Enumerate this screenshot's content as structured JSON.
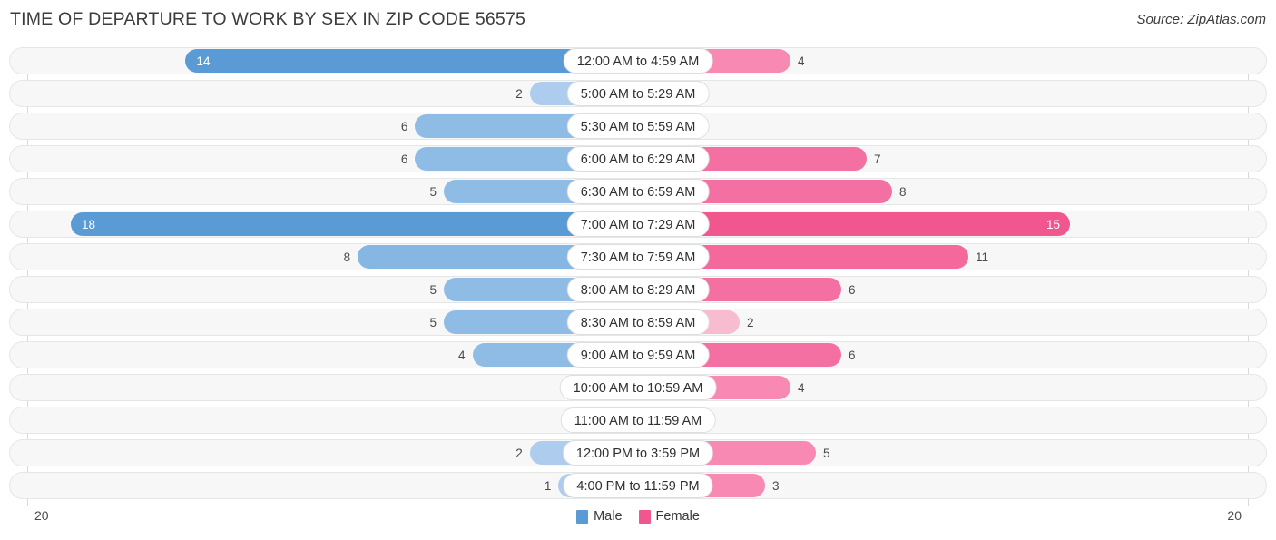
{
  "header": {
    "title": "TIME OF DEPARTURE TO WORK BY SEX IN ZIP CODE 56575",
    "source": "Source: ZipAtlas.com"
  },
  "axis": {
    "left_label": "20",
    "right_label": "20"
  },
  "legend": {
    "items": [
      {
        "label": "Male",
        "color": "#5b9bd5"
      },
      {
        "label": "Female",
        "color": "#f2568f"
      }
    ]
  },
  "chart_data": {
    "type": "bar",
    "orientation": "horizontal-diverging",
    "title": "TIME OF DEPARTURE TO WORK BY SEX IN ZIP CODE 56575",
    "xlabel": "",
    "ylabel": "",
    "xlim": [
      20,
      20
    ],
    "grid": true,
    "legend_position": "bottom-center",
    "categories": [
      "12:00 AM to 4:59 AM",
      "5:00 AM to 5:29 AM",
      "5:30 AM to 5:59 AM",
      "6:00 AM to 6:29 AM",
      "6:30 AM to 6:59 AM",
      "7:00 AM to 7:29 AM",
      "7:30 AM to 7:59 AM",
      "8:00 AM to 8:29 AM",
      "8:30 AM to 8:59 AM",
      "9:00 AM to 9:59 AM",
      "10:00 AM to 10:59 AM",
      "11:00 AM to 11:59 AM",
      "12:00 PM to 3:59 PM",
      "4:00 PM to 11:59 PM"
    ],
    "series": [
      {
        "name": "Male",
        "values": [
          14,
          2,
          6,
          6,
          5,
          18,
          8,
          5,
          5,
          4,
          0,
          0,
          2,
          1
        ]
      },
      {
        "name": "Female",
        "values": [
          4,
          0,
          0,
          7,
          8,
          15,
          11,
          6,
          2,
          6,
          4,
          0,
          5,
          3
        ]
      }
    ]
  },
  "rows": [
    {
      "label": "12:00 AM to 4:59 AM",
      "male": "14",
      "female": "4",
      "male_v": 14,
      "female_v": 4
    },
    {
      "label": "5:00 AM to 5:29 AM",
      "male": "2",
      "female": "0",
      "male_v": 2,
      "female_v": 0
    },
    {
      "label": "5:30 AM to 5:59 AM",
      "male": "6",
      "female": "0",
      "male_v": 6,
      "female_v": 0
    },
    {
      "label": "6:00 AM to 6:29 AM",
      "male": "6",
      "female": "7",
      "male_v": 6,
      "female_v": 7
    },
    {
      "label": "6:30 AM to 6:59 AM",
      "male": "5",
      "female": "8",
      "male_v": 5,
      "female_v": 8
    },
    {
      "label": "7:00 AM to 7:29 AM",
      "male": "18",
      "female": "15",
      "male_v": 18,
      "female_v": 15
    },
    {
      "label": "7:30 AM to 7:59 AM",
      "male": "8",
      "female": "11",
      "male_v": 8,
      "female_v": 11
    },
    {
      "label": "8:00 AM to 8:29 AM",
      "male": "5",
      "female": "6",
      "male_v": 5,
      "female_v": 6
    },
    {
      "label": "8:30 AM to 8:59 AM",
      "male": "5",
      "female": "2",
      "male_v": 5,
      "female_v": 2
    },
    {
      "label": "9:00 AM to 9:59 AM",
      "male": "4",
      "female": "6",
      "male_v": 4,
      "female_v": 6
    },
    {
      "label": "10:00 AM to 10:59 AM",
      "male": "0",
      "female": "4",
      "male_v": 0,
      "female_v": 4
    },
    {
      "label": "11:00 AM to 11:59 AM",
      "male": "0",
      "female": "0",
      "male_v": 0,
      "female_v": 0
    },
    {
      "label": "12:00 PM to 3:59 PM",
      "male": "2",
      "female": "5",
      "male_v": 2,
      "female_v": 5
    },
    {
      "label": "4:00 PM to 11:59 PM",
      "male": "1",
      "female": "3",
      "male_v": 1,
      "female_v": 3
    }
  ]
}
